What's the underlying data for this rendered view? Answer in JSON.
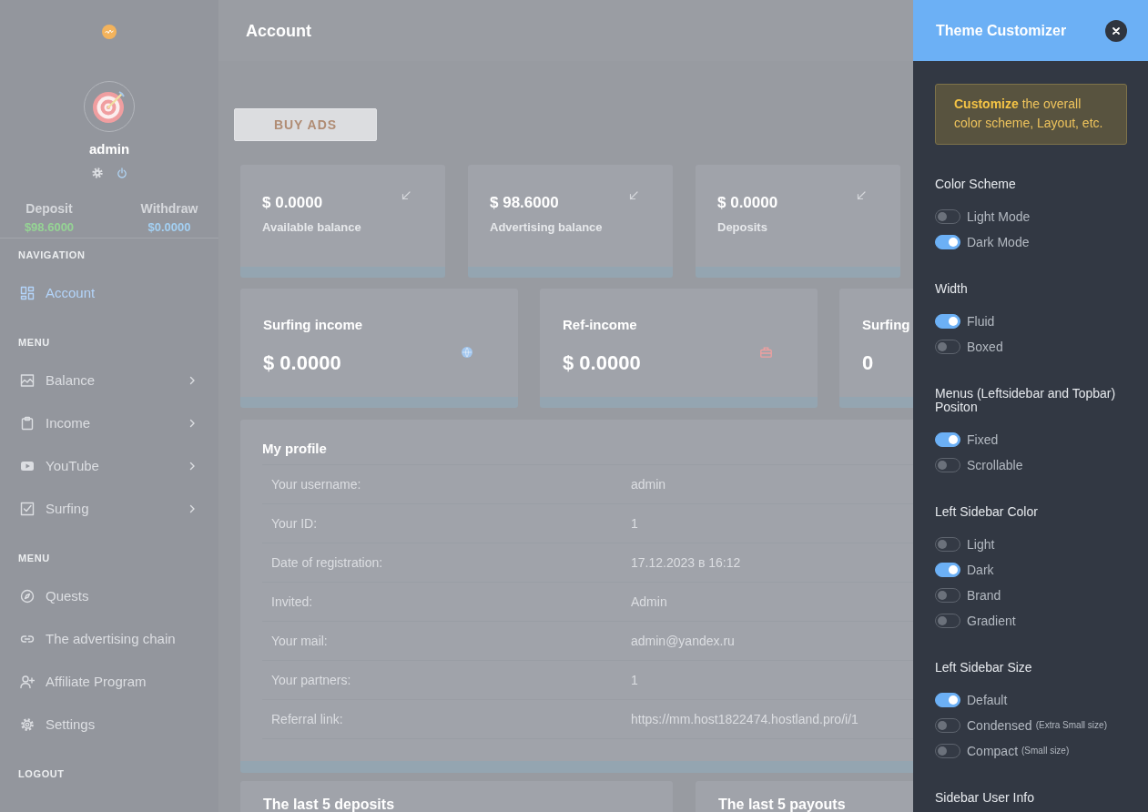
{
  "sidebar": {
    "user": {
      "name": "admin"
    },
    "balances": [
      {
        "label": "Deposit",
        "value": "$98.6000",
        "color": "#95d494"
      },
      {
        "label": "Withdraw",
        "value": "$0.0000",
        "color": "#a3d0f3"
      }
    ],
    "sections": [
      {
        "title": "NAVIGATION",
        "items": [
          {
            "label": "Account",
            "selected": true
          }
        ]
      },
      {
        "title": "MENU",
        "items": [
          {
            "label": "Balance",
            "selected": false,
            "expanded": false
          },
          {
            "label": "Income",
            "selected": false,
            "expanded": false
          },
          {
            "label": "YouTube",
            "selected": false,
            "expanded": false
          },
          {
            "label": "Surfing",
            "selected": false,
            "expanded": false
          }
        ]
      },
      {
        "title": "MENU",
        "items": [
          {
            "label": "Quests",
            "selected": false
          },
          {
            "label": "The advertising chain",
            "selected": false
          },
          {
            "label": "Affiliate Program",
            "selected": false
          },
          {
            "label": "Settings",
            "selected": false
          }
        ]
      },
      {
        "title": "LOGOUT"
      }
    ]
  },
  "topbar": {
    "title": "Account"
  },
  "content": {
    "buy_button": "BUY ADS",
    "balance_cards": [
      {
        "value": "$ 0.0000",
        "label": "Available balance"
      },
      {
        "value": "$ 98.6000",
        "label": "Advertising balance"
      },
      {
        "value": "$ 0.0000",
        "label": "Deposits"
      }
    ],
    "income_cards": [
      {
        "title": "Surfing income",
        "value": "$ 0.0000",
        "color": "#a3c8f0"
      },
      {
        "title": "Ref-income",
        "value": "$ 0.0000",
        "color": "#f0a0a0"
      },
      {
        "title": "Surfing",
        "value": "0"
      }
    ],
    "profile": {
      "title": "My profile",
      "rows": [
        {
          "label": "Your username:",
          "value": "admin"
        },
        {
          "label": "Your ID:",
          "value": "1"
        },
        {
          "label": "Date of registration:",
          "value": "17.12.2023 в 16:12"
        },
        {
          "label": "Invited:",
          "value": "Admin"
        },
        {
          "label": "Your mail:",
          "value": "admin@yandex.ru"
        },
        {
          "label": "Your partners:",
          "value": "1"
        },
        {
          "label": "Referral link:",
          "value": "https://mm.host1822474.hostland.pro/i/1"
        }
      ]
    },
    "history_cards": [
      {
        "title": "The last 5 deposits"
      },
      {
        "title": "The last 5 payouts"
      }
    ]
  },
  "customizer": {
    "title": "Theme Customizer",
    "notice": "**Customize** the overall color scheme, Layout, etc.",
    "groups": [
      {
        "title": "Color Scheme",
        "options": [
          {
            "label": "Light Mode",
            "on": false
          },
          {
            "label": "Dark Mode",
            "on": true
          }
        ]
      },
      {
        "title": "Width",
        "options": [
          {
            "label": "Fluid",
            "on": true
          },
          {
            "label": "Boxed",
            "on": false
          }
        ]
      },
      {
        "title": "Menus (Leftsidebar and Topbar) Positon",
        "options": [
          {
            "label": "Fixed",
            "on": true
          },
          {
            "label": "Scrollable",
            "on": false
          }
        ]
      },
      {
        "title": "Left Sidebar Color",
        "options": [
          {
            "label": "Light",
            "on": false
          },
          {
            "label": "Dark",
            "on": true
          },
          {
            "label": "Brand",
            "on": false
          },
          {
            "label": "Gradient",
            "on": false
          }
        ]
      },
      {
        "title": "Left Sidebar Size",
        "options": [
          {
            "label": "Default",
            "on": true
          },
          {
            "label": "Condensed",
            "note": "(Extra Small size)",
            "on": false
          },
          {
            "label": "Compact",
            "note": "(Small size)",
            "on": false
          }
        ]
      },
      {
        "title": "Sidebar User Info"
      }
    ]
  }
}
